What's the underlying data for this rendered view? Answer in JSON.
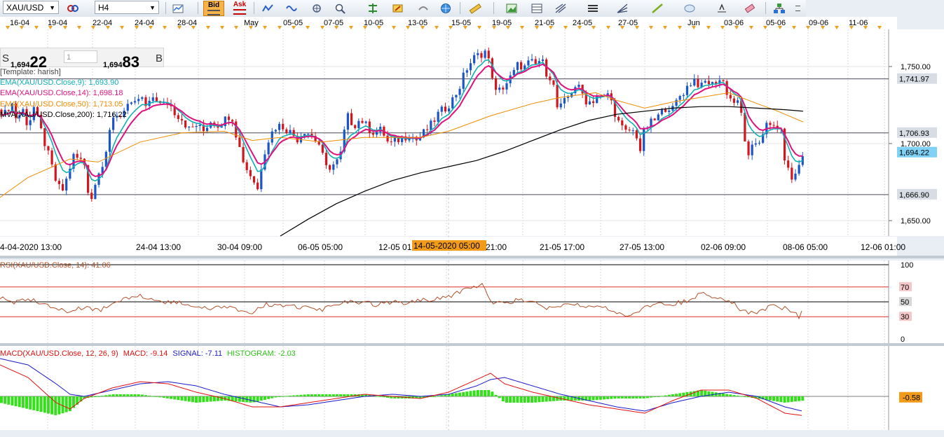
{
  "toolbar": {
    "symbol": "XAU/USD",
    "timeframe": "H4",
    "bid_label": "Bid",
    "ask_label": "Ask"
  },
  "quote": {
    "sell_label": "S",
    "sell_small": "1,694",
    "sell_big": "22",
    "lot_value": "1",
    "buy_small": "1,694",
    "buy_big": "83",
    "buy_label": "B"
  },
  "legend": {
    "template": "[Template: harish]",
    "ema9": "EMA(XAU/USD.Close,9): 1,693.90",
    "ema14": "EMA(XAU/USD.Close,14): 1,698.18",
    "ema50": "EMA(XAU/USD.Close,50): 1,713.05",
    "ma200": "MVA(XAU/USD.Close,200): 1,716.22"
  },
  "colors": {
    "bull": "#1b55c8",
    "bear": "#d2161e",
    "ema9": "#12b0b6",
    "ema14": "#e0117f",
    "ema50": "#f08c00",
    "ma200": "#000000",
    "rsi": "#b1522b",
    "macd": "#e01010",
    "signal": "#1a1acc",
    "histogram": "#33e01a",
    "current_price_box": "#7fd1f5",
    "level_box": "#d8dce4",
    "date_highlight": "#f29b1b"
  },
  "chart_data": [
    {
      "type": "candlestick",
      "symbol": "XAU/USD",
      "timeframe": "H4",
      "top_dates": [
        "16-04",
        "19-04",
        "22-04",
        "24-04",
        "28-04",
        "May",
        "05-05",
        "07-05",
        "10-05",
        "13-05",
        "15-05",
        "19-05",
        "21-05",
        "24-05",
        "27-05",
        "Jun",
        "03-06",
        "05-06",
        "09-06",
        "11-06"
      ],
      "bottom_dates": [
        "4-04-2020 13:00",
        "24-04 13:00",
        "30-04 09:00",
        "06-05 05:00",
        "12-05 01:",
        "14-05-2020 05:00",
        "21:00",
        "21-05 17:00",
        "27-05 13:00",
        "02-06 09:00",
        "08-06 05:00",
        "12-06 01:00"
      ],
      "highlighted_date": "14-05-2020 05:00",
      "ylim": [
        1640,
        1765
      ],
      "y_ticks": [
        1650.0,
        1700.0,
        1750.0
      ],
      "y_tick_labels": [
        "1,650.00",
        "1,700.00",
        "1,750.00"
      ],
      "horizontal_levels": [
        1741.97,
        1706.93,
        1666.9
      ],
      "horizontal_level_labels": [
        "1,741.97",
        "1,706.93",
        "1,666.90"
      ],
      "current_price": 1694.22,
      "current_price_label": "1,694.22",
      "price_path": [
        [
          0,
          1722
        ],
        [
          8,
          1719
        ],
        [
          16,
          1728
        ],
        [
          24,
          1715
        ],
        [
          32,
          1723
        ],
        [
          40,
          1711
        ],
        [
          48,
          1724
        ],
        [
          56,
          1712
        ],
        [
          64,
          1700
        ],
        [
          72,
          1688
        ],
        [
          80,
          1675
        ],
        [
          88,
          1668
        ],
        [
          96,
          1678
        ],
        [
          104,
          1692
        ],
        [
          112,
          1690
        ],
        [
          120,
          1688
        ],
        [
          126,
          1669
        ],
        [
          132,
          1664
        ],
        [
          140,
          1683
        ],
        [
          148,
          1688
        ],
        [
          156,
          1705
        ],
        [
          164,
          1720
        ],
        [
          172,
          1718
        ],
        [
          180,
          1726
        ],
        [
          190,
          1723
        ],
        [
          200,
          1731
        ],
        [
          210,
          1722
        ],
        [
          220,
          1732
        ],
        [
          230,
          1724
        ],
        [
          240,
          1727
        ],
        [
          250,
          1720
        ],
        [
          260,
          1716
        ],
        [
          270,
          1709
        ],
        [
          280,
          1712
        ],
        [
          290,
          1708
        ],
        [
          300,
          1715
        ],
        [
          310,
          1712
        ],
        [
          320,
          1715
        ],
        [
          330,
          1720
        ],
        [
          340,
          1700
        ],
        [
          350,
          1685
        ],
        [
          360,
          1678
        ],
        [
          368,
          1670
        ],
        [
          375,
          1692
        ],
        [
          385,
          1705
        ],
        [
          395,
          1712
        ],
        [
          405,
          1711
        ],
        [
          415,
          1707
        ],
        [
          425,
          1703
        ],
        [
          435,
          1709
        ],
        [
          445,
          1705
        ],
        [
          455,
          1700
        ],
        [
          465,
          1684
        ],
        [
          475,
          1686
        ],
        [
          485,
          1690
        ],
        [
          495,
          1718
        ],
        [
          505,
          1712
        ],
        [
          515,
          1716
        ],
        [
          525,
          1710
        ],
        [
          535,
          1707
        ],
        [
          545,
          1709
        ],
        [
          555,
          1699
        ],
        [
          565,
          1702
        ],
        [
          575,
          1704
        ],
        [
          585,
          1706
        ],
        [
          595,
          1702
        ],
        [
          605,
          1707
        ],
        [
          615,
          1712
        ],
        [
          625,
          1719
        ],
        [
          635,
          1723
        ],
        [
          645,
          1728
        ],
        [
          655,
          1736
        ],
        [
          665,
          1748
        ],
        [
          675,
          1755
        ],
        [
          685,
          1758
        ],
        [
          692,
          1760
        ],
        [
          700,
          1750
        ],
        [
          708,
          1732
        ],
        [
          716,
          1736
        ],
        [
          724,
          1740
        ],
        [
          732,
          1745
        ],
        [
          740,
          1752
        ],
        [
          748,
          1749
        ],
        [
          756,
          1753
        ],
        [
          764,
          1751
        ],
        [
          772,
          1755
        ],
        [
          780,
          1746
        ],
        [
          788,
          1742
        ],
        [
          796,
          1721
        ],
        [
          804,
          1726
        ],
        [
          812,
          1731
        ],
        [
          820,
          1738
        ],
        [
          828,
          1735
        ],
        [
          836,
          1728
        ],
        [
          844,
          1727
        ],
        [
          852,
          1731
        ],
        [
          860,
          1729
        ],
        [
          868,
          1733
        ],
        [
          876,
          1722
        ],
        [
          884,
          1712
        ],
        [
          892,
          1707
        ],
        [
          900,
          1709
        ],
        [
          908,
          1706
        ],
        [
          914,
          1695
        ],
        [
          920,
          1710
        ],
        [
          928,
          1713
        ],
        [
          936,
          1716
        ],
        [
          944,
          1720
        ],
        [
          952,
          1725
        ],
        [
          960,
          1722
        ],
        [
          968,
          1730
        ],
        [
          976,
          1734
        ],
        [
          984,
          1739
        ],
        [
          992,
          1742
        ],
        [
          1000,
          1736
        ],
        [
          1008,
          1741
        ],
        [
          1016,
          1738
        ],
        [
          1024,
          1742
        ],
        [
          1032,
          1740
        ],
        [
          1040,
          1730
        ],
        [
          1048,
          1727
        ],
        [
          1056,
          1725
        ],
        [
          1062,
          1705
        ],
        [
          1068,
          1690
        ],
        [
          1076,
          1700
        ],
        [
          1084,
          1702
        ],
        [
          1092,
          1712
        ],
        [
          1100,
          1710
        ],
        [
          1108,
          1712
        ],
        [
          1114,
          1708
        ],
        [
          1120,
          1690
        ],
        [
          1126,
          1680
        ],
        [
          1132,
          1676
        ],
        [
          1140,
          1686
        ],
        [
          1146,
          1694
        ]
      ],
      "ema50_path": [
        [
          0,
          1665
        ],
        [
          40,
          1678
        ],
        [
          100,
          1690
        ],
        [
          140,
          1688
        ],
        [
          200,
          1701
        ],
        [
          260,
          1707
        ],
        [
          320,
          1708
        ],
        [
          360,
          1702
        ],
        [
          400,
          1704
        ],
        [
          460,
          1701
        ],
        [
          520,
          1704
        ],
        [
          600,
          1704
        ],
        [
          640,
          1708
        ],
        [
          700,
          1718
        ],
        [
          760,
          1726
        ],
        [
          800,
          1730
        ],
        [
          850,
          1733
        ],
        [
          880,
          1728
        ],
        [
          920,
          1723
        ],
        [
          960,
          1727
        ],
        [
          1000,
          1730
        ],
        [
          1040,
          1733
        ],
        [
          1080,
          1726
        ],
        [
          1110,
          1721
        ],
        [
          1146,
          1714
        ]
      ],
      "ma200_path": [
        [
          400,
          1640
        ],
        [
          440,
          1651
        ],
        [
          480,
          1661
        ],
        [
          520,
          1669
        ],
        [
          560,
          1676
        ],
        [
          600,
          1681
        ],
        [
          640,
          1685
        ],
        [
          680,
          1689
        ],
        [
          720,
          1695
        ],
        [
          760,
          1702
        ],
        [
          800,
          1709
        ],
        [
          840,
          1715
        ],
        [
          880,
          1719
        ],
        [
          920,
          1721
        ],
        [
          960,
          1723
        ],
        [
          1000,
          1724
        ],
        [
          1040,
          1724
        ],
        [
          1080,
          1723
        ],
        [
          1120,
          1722
        ],
        [
          1146,
          1721
        ]
      ]
    },
    {
      "type": "line",
      "name": "RSI(XAU/USD.Close, 14): 41.06",
      "ylim": [
        0,
        100
      ],
      "y_ticks": [
        0,
        30,
        50,
        70,
        100
      ],
      "reference_lines": [
        30,
        50,
        70
      ],
      "x": [
        0,
        20,
        40,
        60,
        80,
        100,
        120,
        140,
        160,
        180,
        200,
        220,
        240,
        260,
        280,
        300,
        320,
        340,
        360,
        380,
        400,
        420,
        440,
        460,
        480,
        500,
        520,
        540,
        560,
        580,
        600,
        620,
        640,
        660,
        680,
        690,
        700,
        720,
        740,
        760,
        780,
        800,
        820,
        840,
        860,
        880,
        900,
        920,
        940,
        960,
        980,
        1000,
        1020,
        1040,
        1060,
        1080,
        1100,
        1120,
        1140,
        1146
      ],
      "values": [
        56,
        50,
        54,
        49,
        42,
        36,
        43,
        38,
        46,
        55,
        58,
        52,
        49,
        48,
        44,
        40,
        43,
        39,
        36,
        46,
        45,
        44,
        42,
        40,
        47,
        50,
        49,
        46,
        50,
        48,
        52,
        54,
        57,
        65,
        70,
        74,
        50,
        48,
        53,
        51,
        40,
        44,
        48,
        42,
        45,
        36,
        32,
        42,
        48,
        47,
        51,
        62,
        57,
        52,
        38,
        34,
        44,
        42,
        30,
        41
      ]
    },
    {
      "type": "line",
      "name": "MACD(XAU/USD.Close, 12, 26, 9)",
      "macd_label": "MACD: -9.14",
      "signal_label": "SIGNAL: -7.11",
      "histogram_label": "HISTOGRAM: -2.03",
      "current_value_label": "-0.58",
      "ylim": [
        -14,
        22
      ],
      "x": [
        0,
        40,
        80,
        100,
        120,
        160,
        200,
        240,
        280,
        320,
        360,
        400,
        440,
        480,
        520,
        560,
        600,
        640,
        680,
        700,
        720,
        760,
        800,
        840,
        880,
        920,
        960,
        1000,
        1040,
        1080,
        1120,
        1146
      ],
      "macd": [
        15,
        9,
        -3,
        -6,
        -1,
        4,
        7,
        6,
        2,
        -1,
        -5,
        -5,
        -3,
        -1,
        1,
        0,
        -1,
        2,
        8,
        11,
        6,
        2,
        -1,
        -4,
        -6,
        -8,
        -2,
        3,
        3,
        -1,
        -8,
        -9.14
      ],
      "signal": [
        18,
        15,
        6,
        1,
        0,
        3,
        6,
        7,
        5,
        1,
        -2,
        -5,
        -4,
        -2,
        0,
        1,
        0,
        1,
        5,
        8,
        9,
        5,
        1,
        -2,
        -5,
        -7,
        -3,
        0,
        2,
        0,
        -5,
        -7.11
      ],
      "histogram": [
        -3,
        -6,
        -9,
        -7,
        -1,
        1,
        1,
        -1,
        -3,
        -2,
        -3,
        0,
        1,
        1,
        1,
        -1,
        -1,
        1,
        3,
        3,
        -3,
        -3,
        -2,
        -2,
        -1,
        -1,
        1,
        3,
        1,
        -1,
        -3,
        -2.03
      ]
    }
  ]
}
